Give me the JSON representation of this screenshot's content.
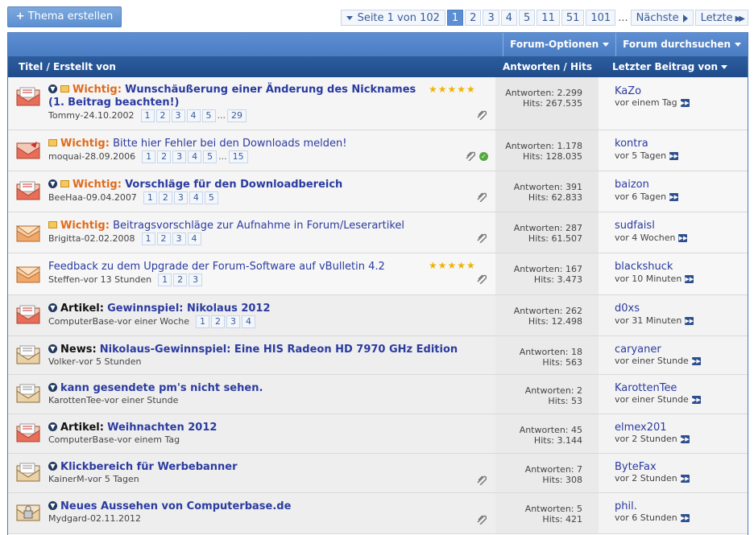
{
  "toolbar": {
    "new_thread": "Thema erstellen"
  },
  "pagination": {
    "label": "Seite 1 von 102",
    "pages": [
      "1",
      "2",
      "3",
      "4",
      "5",
      "11",
      "51",
      "101"
    ],
    "active": "1",
    "dots": "...",
    "next": "Nächste",
    "last": "Letzte"
  },
  "options": {
    "forum_options": "Forum-Optionen",
    "forum_search": "Forum durchsuchen"
  },
  "columns": {
    "title": "Titel / Erstellt von",
    "replies_hits": "Antworten / Hits",
    "last_post": "Letzter Beitrag von"
  },
  "colors": {
    "accent": "#4a7cc2",
    "header_dark": "#1f4b8a",
    "link": "#2b3ba0",
    "important": "#e06a1a"
  },
  "threads": [
    {
      "prefix": "Wichtig:",
      "title_line1": "Wunschäußerung einer Änderung des Nicknames (1.",
      "title_line2": "Beitrag beachten!)",
      "author": "Tommy",
      "date": "24.10.2002",
      "pages": [
        "1",
        "2",
        "3",
        "4",
        "5"
      ],
      "dots": "...",
      "last_page": "29",
      "replies": "Antworten: 2.299",
      "hits": "Hits: 267.535",
      "last_user": "KaZo",
      "last_time": "vor einem Tag",
      "rating": 5
    },
    {
      "prefix": "Wichtig:",
      "title": "Bitte hier Fehler bei den Downloads melden!",
      "author": "moquai",
      "date": "28.09.2006",
      "pages": [
        "1",
        "2",
        "3",
        "4",
        "5"
      ],
      "dots": "...",
      "last_page": "15",
      "replies": "Antworten: 1.178",
      "hits": "Hits: 128.035",
      "last_user": "kontra",
      "last_time": "vor 5 Tagen"
    },
    {
      "prefix": "Wichtig:",
      "title": "Vorschläge für den Downloadbereich",
      "author": "BeeHaa",
      "date": "09.04.2007",
      "pages": [
        "1",
        "2",
        "3",
        "4",
        "5"
      ],
      "replies": "Antworten: 391",
      "hits": "Hits: 62.833",
      "last_user": "baizon",
      "last_time": "vor 6 Tagen"
    },
    {
      "prefix": "Wichtig:",
      "title": "Beitragsvorschläge zur Aufnahme in Forum/Leserartikel",
      "author": "Brigitta",
      "date": "02.02.2008",
      "pages": [
        "1",
        "2",
        "3",
        "4"
      ],
      "replies": "Antworten: 287",
      "hits": "Hits: 61.507",
      "last_user": "sudfaisl",
      "last_time": "vor 4 Wochen"
    },
    {
      "title": "Feedback zu dem Upgrade der Forum-Software auf vBulletin 4.2",
      "author": "Steffen",
      "date": "vor 13 Stunden",
      "pages": [
        "1",
        "2",
        "3"
      ],
      "replies": "Antworten: 167",
      "hits": "Hits: 3.473",
      "last_user": "blackshuck",
      "last_time": "vor 10 Minuten",
      "rating": 5
    },
    {
      "prefix": "Artikel:",
      "title": "Gewinnspiel: Nikolaus 2012",
      "author": "ComputerBase",
      "date": "vor einer Woche",
      "pages": [
        "1",
        "2",
        "3",
        "4"
      ],
      "replies": "Antworten: 262",
      "hits": "Hits: 12.498",
      "last_user": "d0xs",
      "last_time": "vor 31 Minuten"
    },
    {
      "prefix": "News:",
      "title": "Nikolaus-Gewinnspiel: Eine HIS Radeon HD 7970 GHz Edition",
      "author": "Volker",
      "date": "vor 5 Stunden",
      "replies": "Antworten: 18",
      "hits": "Hits: 563",
      "last_user": "caryaner",
      "last_time": "vor einer Stunde"
    },
    {
      "title": "kann gesendete pm's nicht sehen.",
      "author": "KarottenTee",
      "date": "vor einer Stunde",
      "replies": "Antworten: 2",
      "hits": "Hits: 53",
      "last_user": "KarottenTee",
      "last_time": "vor einer Stunde"
    },
    {
      "prefix": "Artikel:",
      "title": "Weihnachten 2012",
      "author": "ComputerBase",
      "date": "vor einem Tag",
      "replies": "Antworten: 45",
      "hits": "Hits: 3.144",
      "last_user": "elmex201",
      "last_time": "vor 2 Stunden"
    },
    {
      "title": "Klickbereich für Werbebanner",
      "author": "KainerM",
      "date": "vor 5 Tagen",
      "replies": "Antworten: 7",
      "hits": "Hits: 308",
      "last_user": "ByteFax",
      "last_time": "vor 2 Stunden"
    },
    {
      "title": "Neues Aussehen von Computerbase.de",
      "author": "Mydgard",
      "date": "02.11.2012",
      "replies": "Antworten: 5",
      "hits": "Hits: 421",
      "last_user": "phil.",
      "last_time": "vor 6 Stunden"
    }
  ],
  "author_sep": " - "
}
